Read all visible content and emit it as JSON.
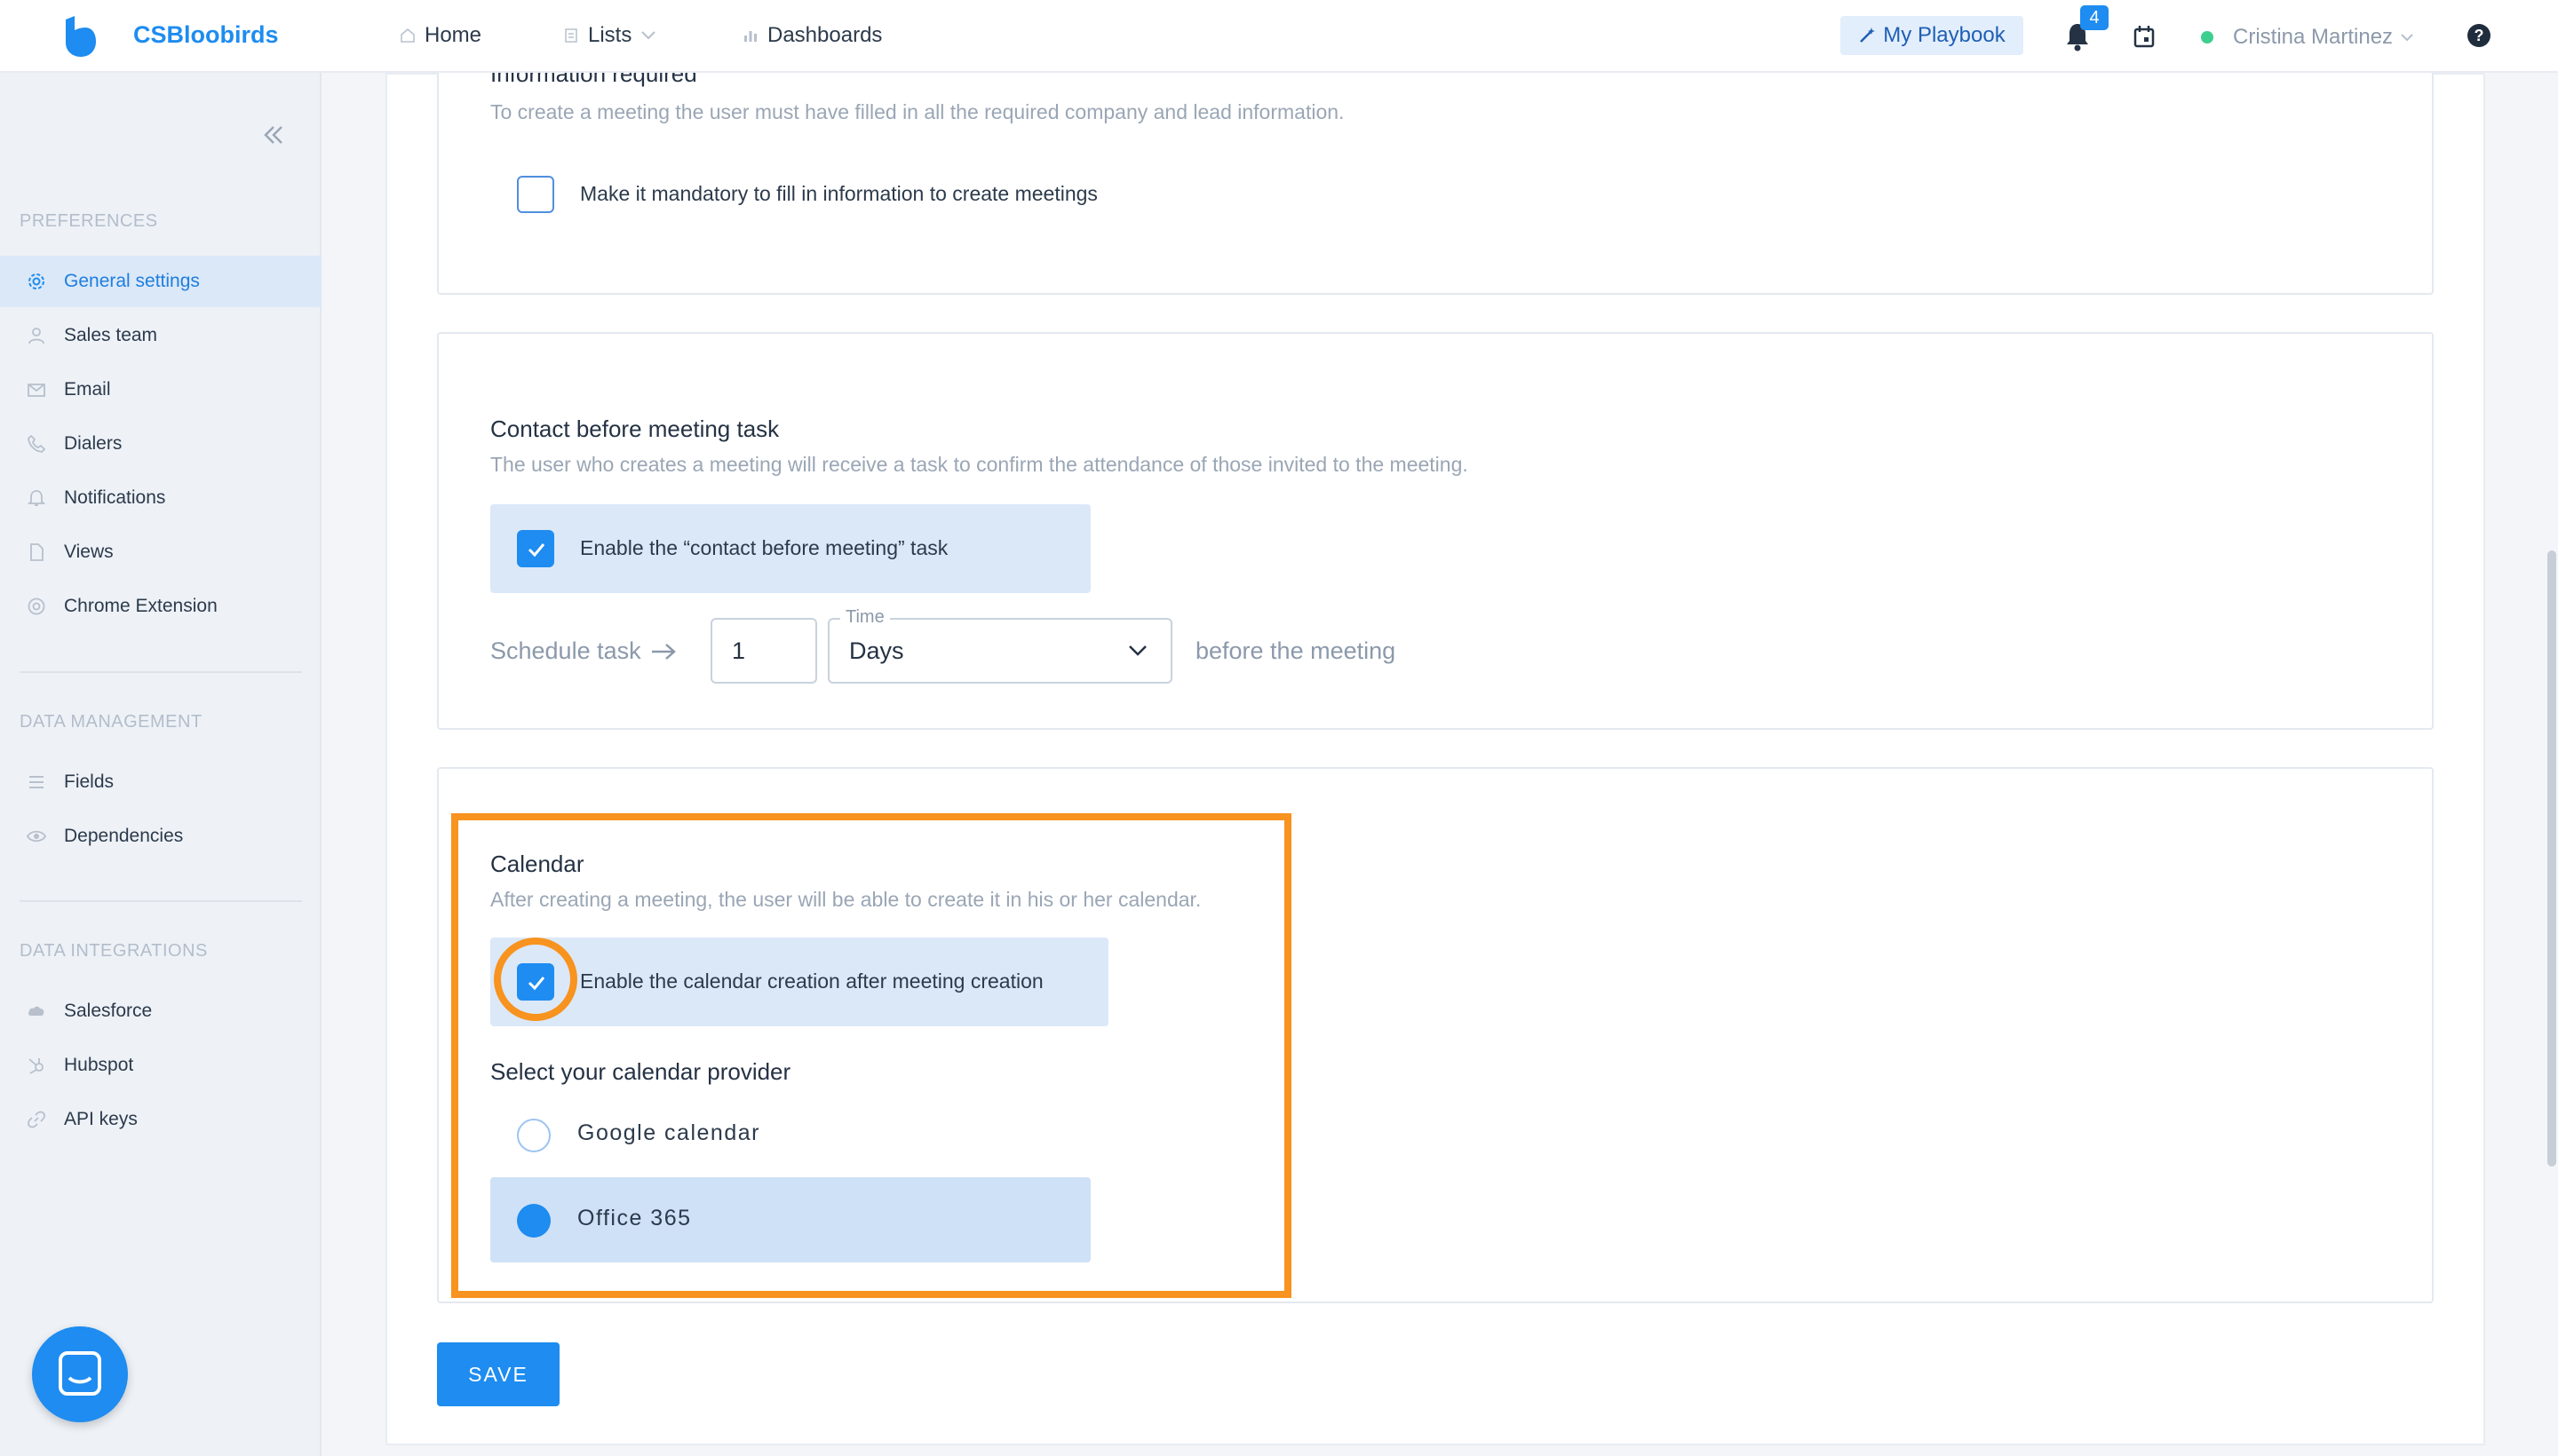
{
  "app": {
    "brand": "CSBloobirds",
    "accent_color": "#1e8cf0",
    "highlight_color": "#f7931e"
  },
  "topnav": {
    "home": "Home",
    "lists": "Lists",
    "dashboards": "Dashboards",
    "playbook": "My Playbook",
    "notification_count": "4",
    "user_name": "Cristina Martinez",
    "help": "?"
  },
  "sidebar": {
    "preferences_label": "PREFERENCES",
    "preferences": [
      {
        "label": "General settings",
        "icon": "gear-icon",
        "active": true
      },
      {
        "label": "Sales team",
        "icon": "user-icon"
      },
      {
        "label": "Email",
        "icon": "envelope-icon"
      },
      {
        "label": "Dialers",
        "icon": "phone-icon"
      },
      {
        "label": "Notifications",
        "icon": "bell-icon"
      },
      {
        "label": "Views",
        "icon": "document-icon"
      },
      {
        "label": "Chrome Extension",
        "icon": "chrome-icon"
      }
    ],
    "data_management_label": "DATA MANAGEMENT",
    "data_management": [
      {
        "label": "Fields",
        "icon": "list-icon"
      },
      {
        "label": "Dependencies",
        "icon": "eye-icon"
      }
    ],
    "data_integrations_label": "DATA INTEGRATIONS",
    "data_integrations": [
      {
        "label": "Salesforce",
        "icon": "cloud-icon"
      },
      {
        "label": "Hubspot",
        "icon": "hubspot-icon"
      },
      {
        "label": "API keys",
        "icon": "link-icon"
      }
    ]
  },
  "info_required": {
    "title": "Information required",
    "description": "To create a meeting the user must have filled in all the required company and lead information.",
    "checkbox_label": "Make it mandatory to fill in information to create meetings",
    "checked": false
  },
  "contact_task": {
    "title": "Contact before meeting task",
    "description": "The user who creates a meeting will receive a task to confirm the attendance of those invited to the meeting.",
    "checkbox_label": "Enable the “contact before meeting” task",
    "checked": true,
    "schedule_label": "Schedule task",
    "amount": "1",
    "time_legend": "Time",
    "time_unit": "Days",
    "after_label": "before the meeting"
  },
  "calendar": {
    "title": "Calendar",
    "description": "After creating a meeting, the user will be able to create it in his or her calendar.",
    "checkbox_label": "Enable the calendar creation after meeting creation",
    "checked": true,
    "provider_title": "Select your calendar provider",
    "providers": [
      {
        "label": "Google calendar",
        "selected": false
      },
      {
        "label": "Office 365",
        "selected": true
      }
    ]
  },
  "actions": {
    "save": "SAVE"
  }
}
